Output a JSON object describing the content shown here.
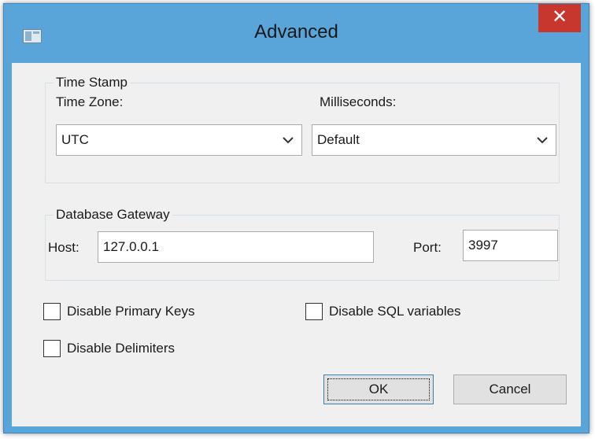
{
  "window": {
    "title": "Advanced",
    "close_glyph": "✕",
    "title_icon": "window-icon"
  },
  "time_stamp": {
    "group_label": "Time Stamp",
    "time_zone_label": "Time Zone:",
    "time_zone_value": "UTC",
    "milliseconds_label": "Milliseconds:",
    "milliseconds_value": "Default"
  },
  "database_gateway": {
    "group_label": "Database Gateway",
    "host_label": "Host:",
    "host_value": "127.0.0.1",
    "port_label": "Port:",
    "port_value": "3997"
  },
  "options": {
    "disable_primary_keys": {
      "label": "Disable Primary Keys",
      "checked": false
    },
    "disable_sql_variables": {
      "label": "Disable SQL variables",
      "checked": false
    },
    "disable_delimiters": {
      "label": "Disable Delimiters",
      "checked": false
    }
  },
  "buttons": {
    "ok": "OK",
    "cancel": "Cancel"
  },
  "colors": {
    "title_bar": "#59a4d8",
    "close_button": "#c8372e",
    "dialog_face": "#f0f0f0"
  }
}
